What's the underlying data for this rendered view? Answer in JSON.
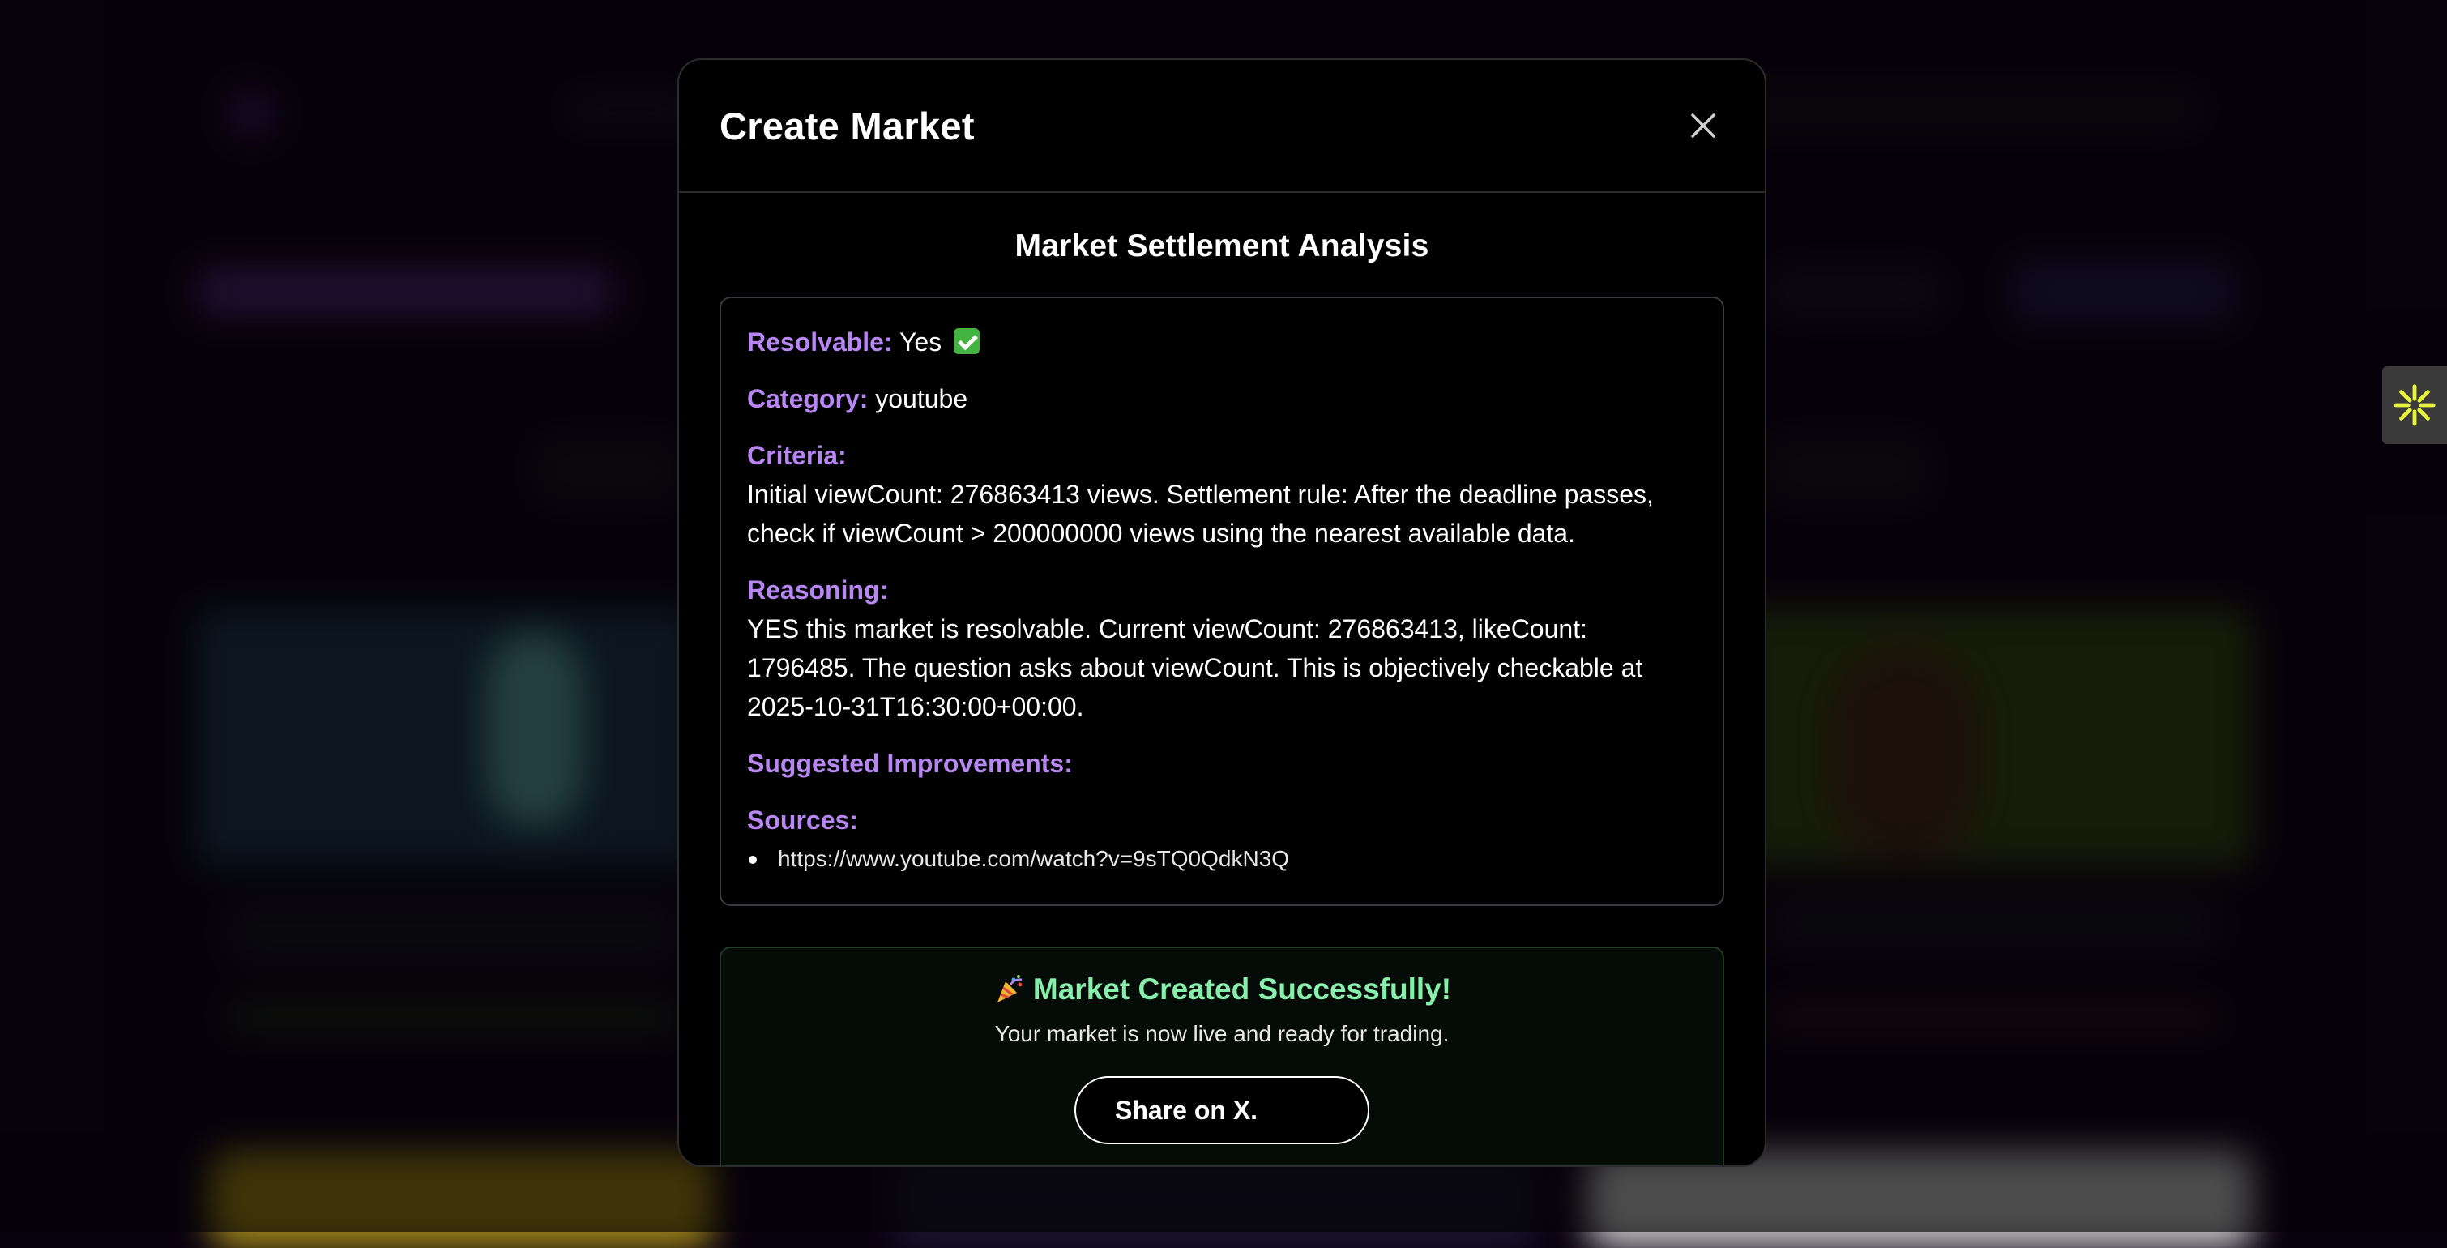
{
  "modal": {
    "title": "Create Market",
    "section_title": "Market Settlement Analysis",
    "analysis": {
      "resolvable_label": "Resolvable:",
      "resolvable_value": "Yes",
      "category_label": "Category:",
      "category_value": "youtube",
      "criteria_label": "Criteria:",
      "criteria_text": "Initial viewCount: 276863413 views. Settlement rule: After the deadline passes, check if viewCount > 200000000 views using the nearest available data.",
      "reasoning_label": "Reasoning:",
      "reasoning_text": "YES this market is resolvable. Current viewCount: 276863413, likeCount: 1796485. The question asks about viewCount. This is objectively checkable at 2025-10-31T16:30:00+00:00.",
      "improvements_label": "Suggested Improvements:",
      "sources_label": "Sources:",
      "sources": [
        "https://www.youtube.com/watch?v=9sTQ0QdkN3Q"
      ]
    },
    "success": {
      "title": "Market Created Successfully!",
      "subtitle": "Your market is now live and ready for trading.",
      "share_label": "Share on X."
    }
  },
  "colors": {
    "accent_label": "#b886f2",
    "success_green": "#86efac",
    "widget_star": "#e6f53a"
  },
  "icons": {
    "close": "close-icon",
    "check": "check-mark-icon",
    "party": "party-popper-icon",
    "widget": "asterisk-star-icon"
  }
}
